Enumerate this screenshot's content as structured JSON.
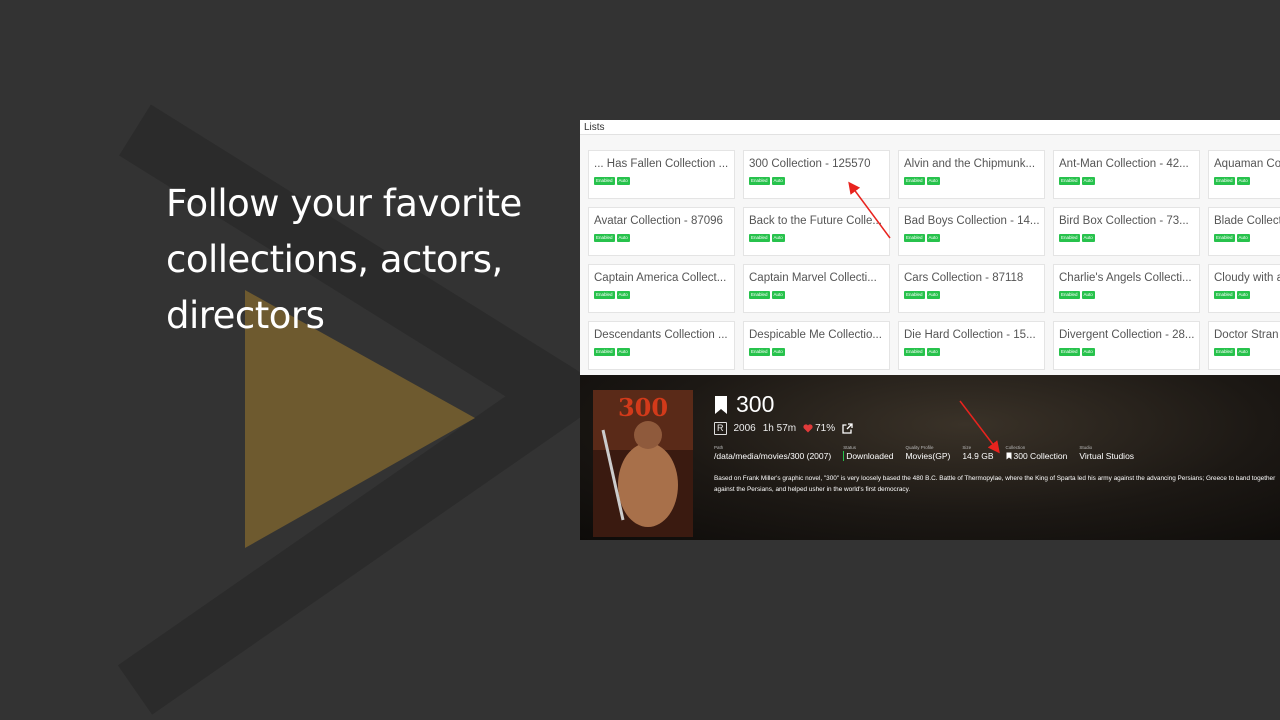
{
  "headline": "Follow your favorite collections, actors, directors",
  "lists": {
    "header": "Lists",
    "cards": [
      {
        "title": "... Has Fallen Collection ...",
        "badges": [
          "Enabled",
          "Auto"
        ]
      },
      {
        "title": "300 Collection - 125570",
        "badges": [
          "Enabled",
          "Auto"
        ]
      },
      {
        "title": "Alvin and the Chipmunk...",
        "badges": [
          "Enabled",
          "Auto"
        ]
      },
      {
        "title": "Ant-Man Collection - 42...",
        "badges": [
          "Enabled",
          "Auto"
        ]
      },
      {
        "title": "Aquaman Co",
        "badges": [
          "Enabled",
          "Auto"
        ]
      },
      {
        "title": "Avatar Collection - 87096",
        "badges": [
          "Enabled",
          "Auto"
        ]
      },
      {
        "title": "Back to the Future Colle...",
        "badges": [
          "Enabled",
          "Auto"
        ]
      },
      {
        "title": "Bad Boys Collection - 14...",
        "badges": [
          "Enabled",
          "Auto"
        ]
      },
      {
        "title": "Bird Box Collection - 73...",
        "badges": [
          "Enabled",
          "Auto"
        ]
      },
      {
        "title": "Blade Collect",
        "badges": [
          "Enabled",
          "Auto"
        ]
      },
      {
        "title": "Captain America Collect...",
        "badges": [
          "Enabled",
          "Auto"
        ]
      },
      {
        "title": "Captain Marvel Collecti...",
        "badges": [
          "Enabled",
          "Auto"
        ]
      },
      {
        "title": "Cars Collection - 87118",
        "badges": [
          "Enabled",
          "Auto"
        ]
      },
      {
        "title": "Charlie's Angels Collecti...",
        "badges": [
          "Enabled",
          "Auto"
        ]
      },
      {
        "title": "Cloudy with a",
        "badges": [
          "Enabled",
          "Auto"
        ]
      },
      {
        "title": "Descendants Collection ...",
        "badges": [
          "Enabled",
          "Auto"
        ]
      },
      {
        "title": "Despicable Me Collectio...",
        "badges": [
          "Enabled",
          "Auto"
        ]
      },
      {
        "title": "Die Hard Collection - 15...",
        "badges": [
          "Enabled",
          "Auto"
        ]
      },
      {
        "title": "Divergent Collection - 28...",
        "badges": [
          "Enabled",
          "Auto"
        ]
      },
      {
        "title": "Doctor Stran",
        "badges": [
          "Enabled",
          "Auto"
        ]
      }
    ]
  },
  "movie": {
    "title": "300",
    "rating": "R",
    "year": "2006",
    "runtime": "1h 57m",
    "score": "71%",
    "poster_text": "300",
    "info": [
      {
        "label": "Path",
        "value": "/data/media/movies/300 (2007)"
      },
      {
        "label": "Status",
        "value": "Downloaded"
      },
      {
        "label": "Quality Profile",
        "value": "Movies(GP)"
      },
      {
        "label": "Size",
        "value": "14.9 GB"
      },
      {
        "label": "Collection",
        "value": "300 Collection"
      },
      {
        "label": "Studio",
        "value": "Virtual Studios"
      }
    ],
    "overview": "Based on Frank Miller's graphic novel, \"300\" is very loosely based the 480 B.C. Battle of Thermopylae, where the King of Sparta led his army against the advancing Persians; Greece to band together against the Persians, and helped usher in the world's first democracy."
  },
  "colors": {
    "background": "#333333",
    "accent_gold": "#6e5a2f",
    "badge_green": "#27c24c",
    "heart_red": "#e03a3a",
    "arrow_red": "#e8231e"
  },
  "icons": [
    "bookmark-icon",
    "heart-icon",
    "external-link-icon",
    "play-logo-icon"
  ]
}
